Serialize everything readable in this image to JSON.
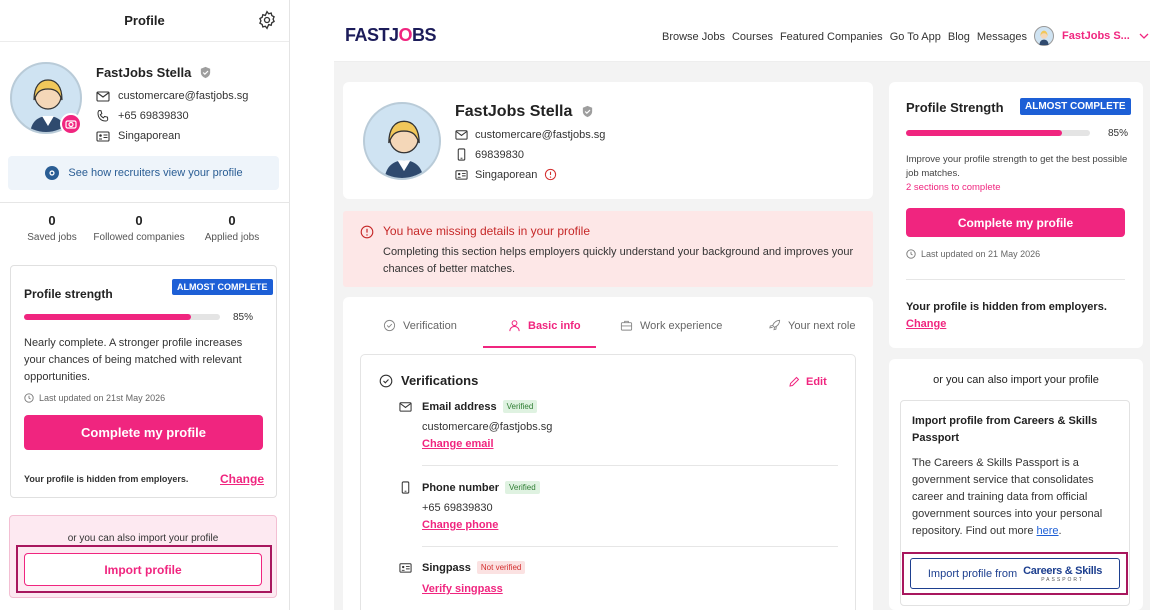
{
  "mobile": {
    "title": "Profile",
    "name": "FastJobs Stella",
    "email": "customercare@fastjobs.sg",
    "phone": "+65 69839830",
    "nationality": "Singaporean",
    "see_recruiters": "See how recruiters view your profile",
    "stats": [
      {
        "value": "0",
        "label": "Saved jobs"
      },
      {
        "value": "0",
        "label": "Followed companies"
      },
      {
        "value": "0",
        "label": "Applied jobs"
      }
    ],
    "strength_title": "Profile strength",
    "strength_badge": "ALMOST COMPLETE",
    "strength_percent_label": "85%",
    "strength_value": 0.85,
    "strength_desc": "Nearly complete. A stronger profile increases your chances of being matched with relevant opportunities.",
    "last_updated": "Last updated on 21st May 2026",
    "complete_btn": "Complete my profile",
    "hidden_text": "Your profile is hidden from employers.",
    "change_link": "Change",
    "import_prompt": "or you can also import your profile",
    "import_btn": "Import profile"
  },
  "nav": {
    "logo_a": "FASTJ",
    "logo_o": "O",
    "logo_b": "BS",
    "links": [
      "Browse Jobs",
      "Courses",
      "Featured Companies",
      "Go To App",
      "Blog",
      "Messages"
    ],
    "user": "FastJobs S..."
  },
  "profile": {
    "name": "FastJobs Stella",
    "email": "customercare@fastjobs.sg",
    "phone": "69839830",
    "nationality": "Singaporean"
  },
  "alert": {
    "title": "You have missing details in your profile",
    "body": "Completing this section helps employers quickly understand your background and improves your chances of better matches."
  },
  "tabs": [
    "Verification",
    "Basic info",
    "Work experience",
    "Your next role"
  ],
  "verifications": {
    "title": "Verifications",
    "edit": "Edit",
    "email_label": "Email address",
    "email_tag": "Verified",
    "email_value": "customercare@fastjobs.sg",
    "email_link": "Change email",
    "phone_label": "Phone number",
    "phone_tag": "Verified",
    "phone_value": "+65 69839830",
    "phone_link": "Change phone",
    "singpass_label": "Singpass",
    "singpass_tag": "Not verified",
    "singpass_link": "Verify singpass"
  },
  "strength": {
    "title": "Profile Strength",
    "badge": "ALMOST COMPLETE",
    "percent_label": "85%",
    "value": 0.85,
    "desc": "Improve your profile strength to get the best possible job matches.",
    "sections": "2 sections to complete",
    "complete_btn": "Complete my profile",
    "last_updated": "Last updated on 21 May 2026",
    "hidden_text": "Your profile is hidden from employers.",
    "change_link": "Change"
  },
  "import": {
    "prompt": "or you can also import your profile",
    "title": "Import profile from Careers & Skills Passport",
    "desc_before": "The Careers & Skills Passport is a government service that consolidates career and training data from official government sources into your personal repository. Find out more ",
    "desc_link": "here",
    "desc_after": ".",
    "btn": "Import profile from",
    "brand": "Careers & Skills",
    "brand_sub": "PASSPORT"
  },
  "colors": {
    "accent": "#f0257f",
    "badge": "#1d5fd6",
    "highlight": "#a8175e"
  }
}
